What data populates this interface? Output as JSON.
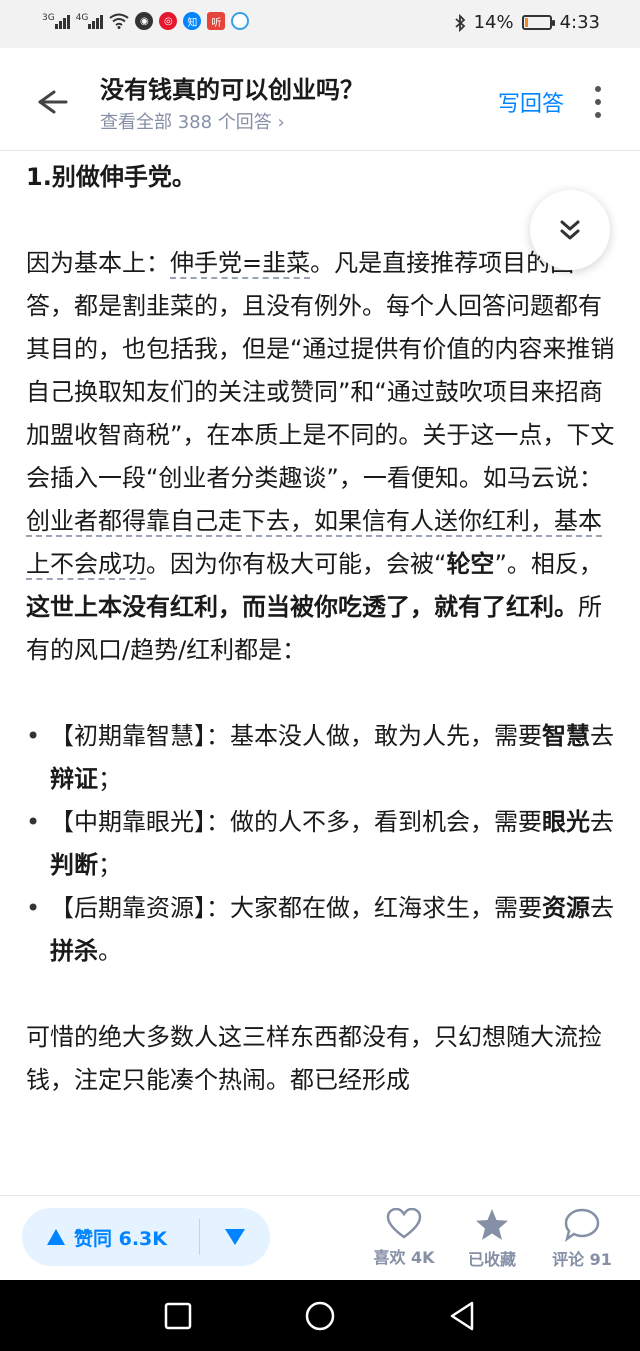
{
  "status": {
    "net1": "3G",
    "net2": "4G",
    "battery_pct": "14%",
    "battery_level": 0.14,
    "time": "4:33"
  },
  "header": {
    "title": "没有钱真的可以创业吗？",
    "subtitle": "查看全部 388 个回答 ›",
    "write_label": "写回答"
  },
  "content": {
    "heading": "1.别做伸手党。",
    "p1_a": "因为基本上：",
    "p1_b": "伸手党=韭菜",
    "p1_c": "。凡是直接推荐",
    "p1_d": "项目的回答，都是割韭菜的，且没有例外。每个人回答问题都有其目的，也包括我，但是“通过提供有价值的内容来推销自己换取知友们的关注或赞同”和“通过鼓吹项目来招商加盟收智商税”，在本质上是不同的。关于这一点，下文会插入一段“创业者分类趣谈”，一看便知。如马云说：",
    "p1_e": "创业者都得靠自己走下去，如果信有人送你红利，基本上不会成功",
    "p1_f": "。因为你有极大可能，会被“",
    "p1_g": "轮空",
    "p1_h": "”。相反，",
    "p1_i": "这世上本没有红利，而当被你吃透了，就有了红利。",
    "p1_j": "所有的风口/趋势/红利都是：",
    "bullets": [
      {
        "a": "【初期靠智慧】：基本没人做，敢为人先，需要",
        "b": "智慧",
        "c": "去",
        "d": "辩证",
        "e": "；"
      },
      {
        "a": "【中期靠眼光】：做的人不多，看到机会，需要",
        "b": "眼光",
        "c": "去",
        "d": "判断",
        "e": "；"
      },
      {
        "a": "【后期靠资源】：大家都在做，红海求生，需要",
        "b": "资源",
        "c": "去",
        "d": "拼杀",
        "e": "。"
      }
    ],
    "p2": "可惜的绝大多数人这三样东西都没有，只幻想随大流捡钱，注定只能凑个热闹。都已经形成"
  },
  "actions": {
    "upvote": "赞同 6.3K",
    "like": "喜欢 4K",
    "collect": "已收藏",
    "comment": "评论 91"
  },
  "colors": {
    "accent": "#0084ff",
    "muted": "#8590a6"
  }
}
